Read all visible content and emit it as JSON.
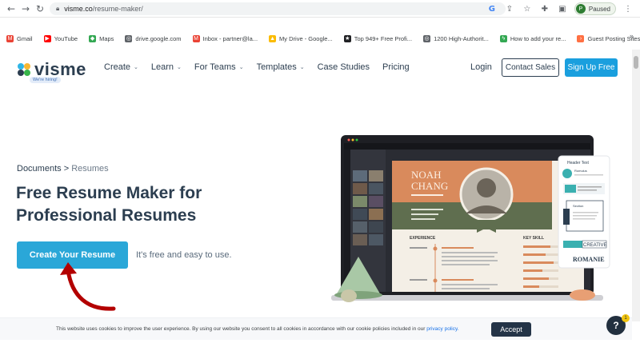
{
  "browser": {
    "url_host": "visme.co",
    "url_path": "/resume-maker/",
    "profile_initial": "P",
    "profile_status": "Paused",
    "bookmarks": [
      {
        "label": "Gmail",
        "color": "#ea4335",
        "glyph": "M"
      },
      {
        "label": "YouTube",
        "color": "#ff0000",
        "glyph": "▶"
      },
      {
        "label": "Maps",
        "color": "#34a853",
        "glyph": "◆"
      },
      {
        "label": "drive.google.com",
        "color": "#5f6368",
        "glyph": "◎"
      },
      {
        "label": "Inbox - partner@la...",
        "color": "#ea4335",
        "glyph": "M"
      },
      {
        "label": "My Drive - Google...",
        "color": "#fbbc04",
        "glyph": "▲"
      },
      {
        "label": "Top 949+ Free Profi...",
        "color": "#202124",
        "glyph": "★"
      },
      {
        "label": "1200 High-Authorit...",
        "color": "#5f6368",
        "glyph": "◎"
      },
      {
        "label": "How to add your re...",
        "color": "#34a853",
        "glyph": "ϟ"
      },
      {
        "label": "Guest Posting Sites...",
        "color": "#ff7043",
        "glyph": "›"
      }
    ]
  },
  "site": {
    "logo_text": "visme",
    "logo_badge": "We're hiring!",
    "menu": [
      "Create",
      "Learn",
      "For Teams",
      "Templates",
      "Case Studies",
      "Pricing"
    ],
    "menu_has_chevron": [
      true,
      true,
      true,
      true,
      false,
      false
    ],
    "login": "Login",
    "contact_sales": "Contact Sales",
    "sign_up": "Sign Up Free",
    "accent_color": "#1a9fde"
  },
  "hero": {
    "crumb_1": "Documents",
    "crumb_sep": ">",
    "crumb_2": "Resumes",
    "title": "Free Resume Maker for Professional Resumes",
    "cta": "Create Your Resume",
    "cta_note": "It's free and easy to use."
  },
  "mockup": {
    "name_1": "NOAH",
    "name_2": "CHANG",
    "experience": "EXPERIENCE",
    "key_skill": "KEY SKILL",
    "panel_title": "Header Text",
    "panel_item_1": "Romulus",
    "panel_item_2": "Section",
    "creative": "CREATIVE",
    "romanie": "ROMANIE"
  },
  "cookie": {
    "text": "This website uses cookies to improve the user experience. By using our website you consent to all cookies in accordance with our cookie policies included in our",
    "link": "privacy policy.",
    "accept": "Accept"
  },
  "help": {
    "glyph": "?",
    "badge": "1"
  }
}
